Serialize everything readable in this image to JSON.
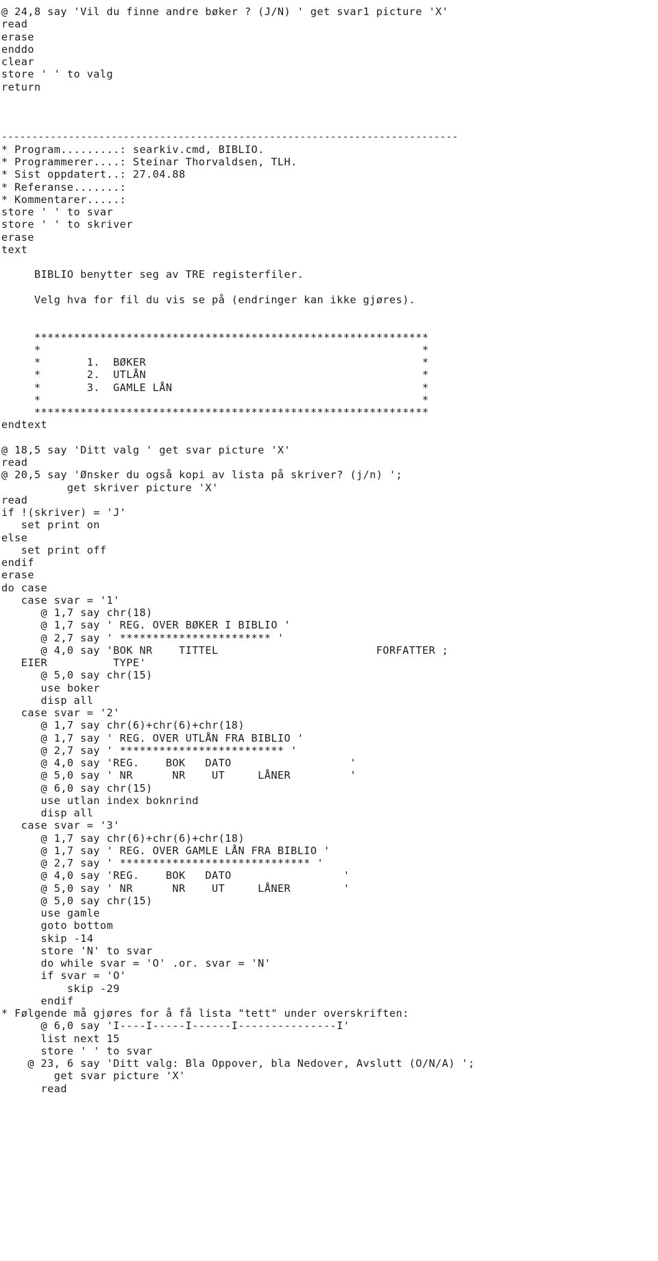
{
  "document": {
    "kind": "source-code-listing",
    "language": "dBASE/Clipper command file",
    "program": "searkiv.cmd, BIBLIO.",
    "programmer": "Steinar Thorvaldsen, TLH.",
    "last_updated": "27.04.88",
    "reference": "",
    "comments": ""
  },
  "header": {
    "divider": "---------------------------------------------------------------------------",
    "program_label": "* Program.........: searkiv.cmd, BIBLIO.",
    "programmer_label": "* Programmerer....: Steinar Thorvaldsen, TLH.",
    "updated_label": "* Sist oppdatert..: 27.04.88",
    "reference_label": "* Referanse.......:",
    "comments_label": "* Kommentarer.....:"
  },
  "menu": {
    "intro_line_1": "BIBLIO benytter seg av TRE registerfiler.",
    "intro_line_2": "Velg hva for fil du vis se på (endringer kan ikke gjøres).",
    "border": "************************************************************",
    "options": [
      "1.  BØKER",
      "2.  UTLÅN",
      "3.  GAMLE LÅN"
    ],
    "prompt_choice": "@ 18,5 say 'Ditt valg ' get svar picture 'X'",
    "prompt_printer": "@ 20,5 say 'Ønsker du også kopi av lista på skriver? (j/n) ';",
    "prompt_nav": "@ 23, 6 say 'Ditt valg: Bla Oppover, bla Nedover, Avslutt (O/N/A) ';"
  },
  "lines": [
    "@ 24,8 say 'Vil du finne andre bøker ? (J/N) ' get svar1 picture 'X'",
    "read",
    "erase",
    "enddo",
    "clear",
    "store ' ' to valg",
    "return",
    "",
    "",
    "",
    "---------------------------------------------------------------------------",
    "* Program.........: searkiv.cmd, BIBLIO.",
    "* Programmerer....: Steinar Thorvaldsen, TLH.",
    "* Sist oppdatert..: 27.04.88",
    "* Referanse.......:",
    "* Kommentarer.....:",
    "store ' ' to svar",
    "store ' ' to skriver",
    "erase",
    "text",
    "",
    "     BIBLIO benytter seg av TRE registerfiler.",
    "",
    "     Velg hva for fil du vis se på (endringer kan ikke gjøres).",
    "",
    "",
    "     ************************************************************",
    "     *                                                          *",
    "     *       1.  BØKER                                          *",
    "     *       2.  UTLÅN                                          *",
    "     *       3.  GAMLE LÅN                                      *",
    "     *                                                          *",
    "     ************************************************************",
    "endtext",
    "",
    "@ 18,5 say 'Ditt valg ' get svar picture 'X'",
    "read",
    "@ 20,5 say 'Ønsker du også kopi av lista på skriver? (j/n) ';",
    "          get skriver picture 'X'",
    "read",
    "if !(skriver) = 'J'",
    "   set print on",
    "else",
    "   set print off",
    "endif",
    "erase",
    "do case",
    "   case svar = '1'",
    "      @ 1,7 say chr(18)",
    "      @ 1,7 say ' REG. OVER BØKER I BIBLIO '",
    "      @ 2,7 say ' *********************** '",
    "      @ 4,0 say 'BOK NR    TITTEL                        FORFATTER ;",
    "   EIER          TYPE'",
    "      @ 5,0 say chr(15)",
    "      use boker",
    "      disp all",
    "   case svar = '2'",
    "      @ 1,7 say chr(6)+chr(6)+chr(18)",
    "      @ 1,7 say ' REG. OVER UTLÅN FRA BIBLIO '",
    "      @ 2,7 say ' ************************* '",
    "      @ 4,0 say 'REG.    BOK   DATO                  '",
    "      @ 5,0 say ' NR      NR    UT     LÅNER         '",
    "      @ 6,0 say chr(15)",
    "      use utlan index boknrind",
    "      disp all",
    "   case svar = '3'",
    "      @ 1,7 say chr(6)+chr(6)+chr(18)",
    "      @ 1,7 say ' REG. OVER GAMLE LÅN FRA BIBLIO '",
    "      @ 2,7 say ' ***************************** '",
    "      @ 4,0 say 'REG.    BOK   DATO                 '",
    "      @ 5,0 say ' NR      NR    UT     LÅNER        '",
    "      @ 5,0 say chr(15)",
    "      use gamle",
    "      goto bottom",
    "      skip -14",
    "      store 'N' to svar",
    "      do while svar = 'O' .or. svar = 'N'",
    "      if svar = 'O'",
    "          skip -29",
    "      endif",
    "* Følgende må gjøres for å få lista \"tett\" under overskriften:",
    "      @ 6,0 say 'I----I-----I------I---------------I'",
    "      list next 15",
    "      store ' ' to svar",
    "    @ 23, 6 say 'Ditt valg: Bla Oppover, bla Nedover, Avslutt (O/N/A) ';",
    "        get svar picture 'X'",
    "      read"
  ]
}
